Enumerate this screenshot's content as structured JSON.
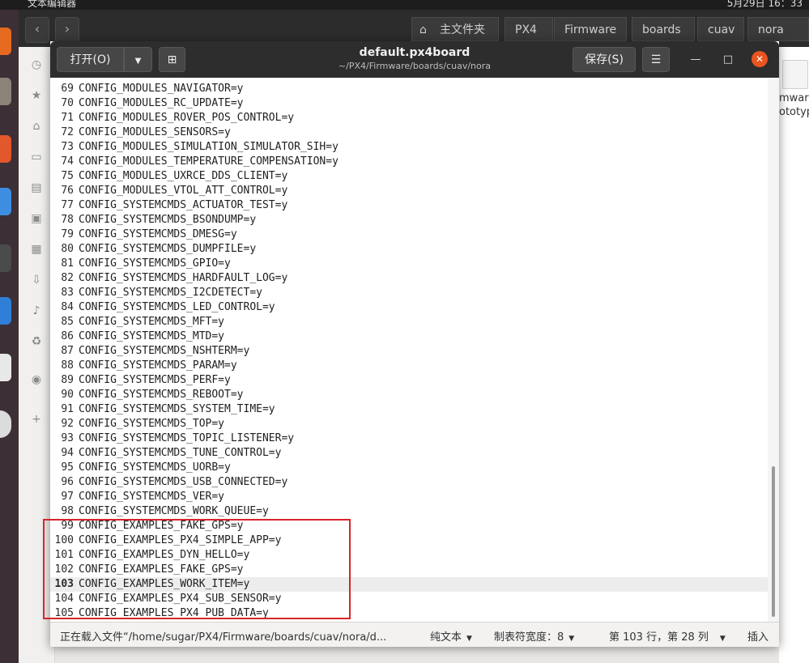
{
  "system": {
    "app_name": "文本编辑器",
    "clock": "5月29日 16：33"
  },
  "file_manager": {
    "breadcrumbs": [
      "主文件夹",
      "PX4",
      "Firmware",
      "boards",
      "cuav",
      "nora"
    ],
    "file_label_1": "mwar",
    "file_label_2": "ototyp"
  },
  "editor": {
    "open_label": "打开(O)",
    "title": "default.px4board",
    "path": "~/PX4/Firmware/boards/cuav/nora",
    "save_label": "保存(S)",
    "lines": [
      {
        "n": "69",
        "text": "CONFIG_MODULES_NAVIGATOR=y"
      },
      {
        "n": "70",
        "text": "CONFIG_MODULES_RC_UPDATE=y"
      },
      {
        "n": "71",
        "text": "CONFIG_MODULES_ROVER_POS_CONTROL=y"
      },
      {
        "n": "72",
        "text": "CONFIG_MODULES_SENSORS=y"
      },
      {
        "n": "73",
        "text": "CONFIG_MODULES_SIMULATION_SIMULATOR_SIH=y"
      },
      {
        "n": "74",
        "text": "CONFIG_MODULES_TEMPERATURE_COMPENSATION=y"
      },
      {
        "n": "75",
        "text": "CONFIG_MODULES_UXRCE_DDS_CLIENT=y"
      },
      {
        "n": "76",
        "text": "CONFIG_MODULES_VTOL_ATT_CONTROL=y"
      },
      {
        "n": "77",
        "text": "CONFIG_SYSTEMCMDS_ACTUATOR_TEST=y"
      },
      {
        "n": "78",
        "text": "CONFIG_SYSTEMCMDS_BSONDUMP=y"
      },
      {
        "n": "79",
        "text": "CONFIG_SYSTEMCMDS_DMESG=y"
      },
      {
        "n": "80",
        "text": "CONFIG_SYSTEMCMDS_DUMPFILE=y"
      },
      {
        "n": "81",
        "text": "CONFIG_SYSTEMCMDS_GPIO=y"
      },
      {
        "n": "82",
        "text": "CONFIG_SYSTEMCMDS_HARDFAULT_LOG=y"
      },
      {
        "n": "83",
        "text": "CONFIG_SYSTEMCMDS_I2CDETECT=y"
      },
      {
        "n": "84",
        "text": "CONFIG_SYSTEMCMDS_LED_CONTROL=y"
      },
      {
        "n": "85",
        "text": "CONFIG_SYSTEMCMDS_MFT=y"
      },
      {
        "n": "86",
        "text": "CONFIG_SYSTEMCMDS_MTD=y"
      },
      {
        "n": "87",
        "text": "CONFIG_SYSTEMCMDS_NSHTERM=y"
      },
      {
        "n": "88",
        "text": "CONFIG_SYSTEMCMDS_PARAM=y"
      },
      {
        "n": "89",
        "text": "CONFIG_SYSTEMCMDS_PERF=y"
      },
      {
        "n": "90",
        "text": "CONFIG_SYSTEMCMDS_REBOOT=y"
      },
      {
        "n": "91",
        "text": "CONFIG_SYSTEMCMDS_SYSTEM_TIME=y"
      },
      {
        "n": "92",
        "text": "CONFIG_SYSTEMCMDS_TOP=y"
      },
      {
        "n": "93",
        "text": "CONFIG_SYSTEMCMDS_TOPIC_LISTENER=y"
      },
      {
        "n": "94",
        "text": "CONFIG_SYSTEMCMDS_TUNE_CONTROL=y"
      },
      {
        "n": "95",
        "text": "CONFIG_SYSTEMCMDS_UORB=y"
      },
      {
        "n": "96",
        "text": "CONFIG_SYSTEMCMDS_USB_CONNECTED=y"
      },
      {
        "n": "97",
        "text": "CONFIG_SYSTEMCMDS_VER=y"
      },
      {
        "n": "98",
        "text": "CONFIG_SYSTEMCMDS_WORK_QUEUE=y"
      },
      {
        "n": "99",
        "text": "CONFIG_EXAMPLES_FAKE_GPS=y"
      },
      {
        "n": "100",
        "text": "CONFIG_EXAMPLES_PX4_SIMPLE_APP=y"
      },
      {
        "n": "101",
        "text": "CONFIG_EXAMPLES_DYN_HELLO=y"
      },
      {
        "n": "102",
        "text": "CONFIG_EXAMPLES_FAKE_GPS=y"
      },
      {
        "n": "103",
        "text": "CONFIG_EXAMPLES_WORK_ITEM=y",
        "current": true
      },
      {
        "n": "104",
        "text": "CONFIG_EXAMPLES_PX4_SUB_SENSOR=y"
      },
      {
        "n": "105",
        "text": "CONFIG_EXAMPLES_PX4_PUB_DATA=y"
      }
    ],
    "status": {
      "loading": "正在载入文件“/home/sugar/PX4/Firmware/boards/cuav/nora/d...",
      "syntax": "纯文本",
      "tab_width": "制表符宽度：8",
      "position": "第 103 行，第 28 列",
      "mode": "插入"
    }
  },
  "colors": {
    "highlight_box": "#d8232a",
    "close_button": "#e95420"
  }
}
